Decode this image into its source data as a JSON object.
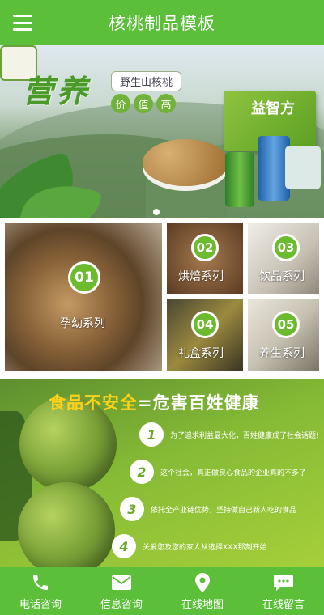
{
  "header": {
    "title": "核桃制品模板"
  },
  "banner": {
    "slogan_main": "营养",
    "tag": "野生山核桃",
    "circle_words": [
      "价",
      "值",
      "高"
    ],
    "product_box_text": "益智方",
    "active_slide_index": 0
  },
  "categories": [
    {
      "num": "01",
      "label": "孕幼系列"
    },
    {
      "num": "02",
      "label": "烘焙系列"
    },
    {
      "num": "03",
      "label": "饮品系列"
    },
    {
      "num": "04",
      "label": "礼盒系列"
    },
    {
      "num": "05",
      "label": "养生系列"
    }
  ],
  "promo": {
    "title_part1": "食品不安全",
    "title_part2": "=危害百姓健康",
    "items": [
      {
        "num": "1",
        "text": "为了追求利益最大化，百姓健康成了社会话题!"
      },
      {
        "num": "2",
        "text": "这个社会，真正做良心食品的企业真的不多了"
      },
      {
        "num": "3",
        "text": "依托全产业链优势，坚持做自己新人吃的食品"
      },
      {
        "num": "4",
        "text": "关爱您及您的家人从选择XXX那刻开始......"
      }
    ]
  },
  "footer": {
    "items": [
      {
        "label": "电话咨询",
        "icon": "phone-icon"
      },
      {
        "label": "信息咨询",
        "icon": "mail-icon"
      },
      {
        "label": "在线地图",
        "icon": "map-pin-icon"
      },
      {
        "label": "在线留言",
        "icon": "chat-icon"
      }
    ]
  },
  "colors": {
    "brand_green": "#5cbf3a",
    "accent_yellow": "#ffd21a"
  }
}
